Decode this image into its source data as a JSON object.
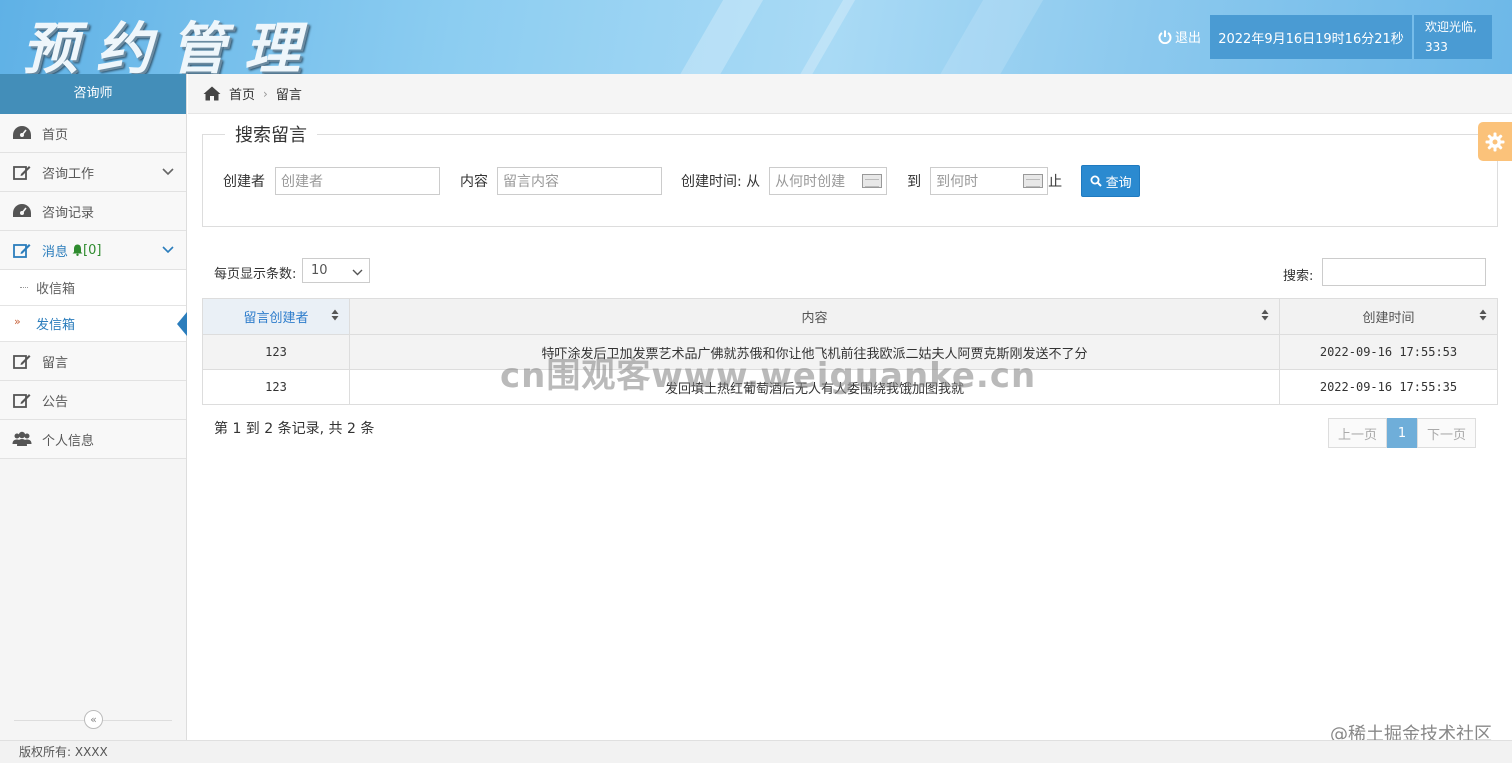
{
  "header": {
    "logo_text": "预约管理",
    "logout_label": "退出",
    "datetime": "2022年9月16日19时16分21秒",
    "welcome_line1": "欢迎光临,",
    "welcome_line2": "333"
  },
  "sidebar": {
    "role": "咨询师",
    "items": [
      {
        "label": "首页",
        "icon": "dashboard-icon"
      },
      {
        "label": "咨询工作",
        "icon": "edit-icon"
      },
      {
        "label": "咨询记录",
        "icon": "dashboard-icon"
      },
      {
        "label": "消息",
        "badge": "[0]",
        "icon": "edit-icon"
      },
      {
        "label": "留言",
        "icon": "edit-icon"
      },
      {
        "label": "公告",
        "icon": "edit-icon"
      },
      {
        "label": "个人信息",
        "icon": "users-icon"
      }
    ],
    "subitems": [
      {
        "label": "收信箱"
      },
      {
        "label": "发信箱"
      }
    ],
    "collapse_glyph": "«"
  },
  "breadcrumb": {
    "home": "首页",
    "current": "留言"
  },
  "search": {
    "legend": "搜索留言",
    "creator_label": "创建者",
    "creator_placeholder": "创建者",
    "content_label": "内容",
    "content_placeholder": "留言内容",
    "time_label": "创建时间: 从",
    "from_placeholder": "从何时创建",
    "to_label": "到",
    "to_placeholder": "到何时",
    "end_label": "止",
    "query_button": "查询"
  },
  "table_controls": {
    "length_label": "每页显示条数:",
    "length_value": "10",
    "search_label": "搜索:"
  },
  "table": {
    "columns": [
      "留言创建者",
      "内容",
      "创建时间"
    ],
    "rows": [
      {
        "creator": "123",
        "content": "特吓涂发后卫加发票艺术品广佛就苏俄和你让他飞机前往我欧派二姑夫人阿贾克斯刚发送不了分",
        "time": "2022-09-16 17:55:53"
      },
      {
        "creator": "123",
        "content": "发回填土热红葡萄酒后无人有人委围绕我饿加图我就",
        "time": "2022-09-16 17:55:35"
      }
    ]
  },
  "pagination": {
    "info": "第 1 到 2 条记录, 共 2 条",
    "prev": "上一页",
    "current": "1",
    "next": "下一页"
  },
  "watermarks": {
    "center": "cn围观客www.weiguanke.cn",
    "corner": "@稀土掘金技术社区"
  },
  "footer": {
    "copyright": "版权所有: XXXX"
  },
  "colors": {
    "primary": "#438eb9",
    "button": "#2b8ad0",
    "badge_green": "#2e8b2e",
    "gear_tab": "#fbc27a"
  }
}
